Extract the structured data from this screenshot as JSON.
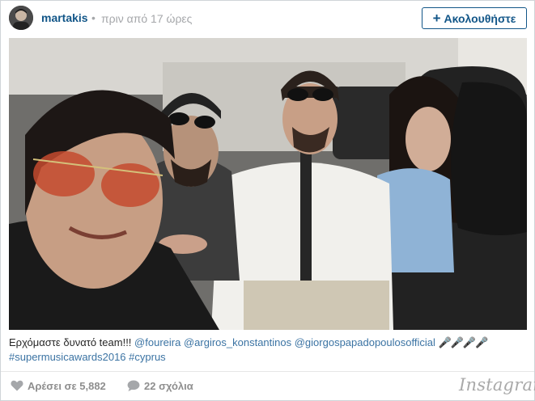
{
  "header": {
    "username": "martakis",
    "separator": "•",
    "timestamp": "πριν από 17 ώρες",
    "follow_label": "Ακολουθήστε",
    "follow_plus": "+"
  },
  "caption": {
    "text": "Ερχόμαστε δυνατό team!!!",
    "mentions": [
      "@foureira",
      "@argiros_konstantinos",
      "@giorgospapadopoulosofficial"
    ],
    "emojis": "🎤🎤🎤🎤",
    "hashtags": [
      "#supermusicawards2016",
      "#cyprus"
    ]
  },
  "footer": {
    "likes_label": "Αρέσει σε 5,882",
    "comments_label": "22 σχόλια",
    "brand": "Instagram"
  },
  "icons": {
    "like": "heart-icon",
    "comment": "comment-icon"
  },
  "colors": {
    "link": "#125688",
    "caption_link": "#3b73a3",
    "muted": "#a5a7aa"
  }
}
